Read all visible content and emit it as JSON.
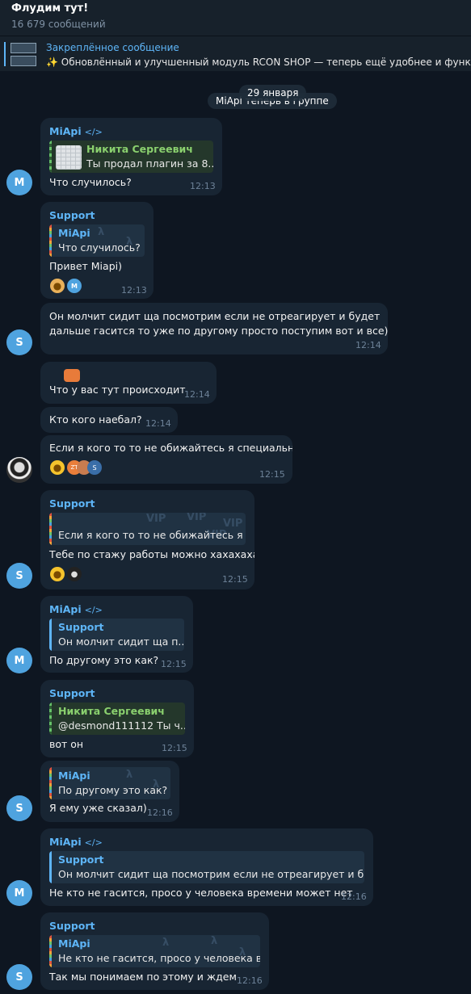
{
  "header": {
    "title": "Флудим тут!",
    "subtitle": "16 679 сообщений"
  },
  "pinned": {
    "label": "Закреплённое сообщение",
    "text": "✨ Обновлённый и улучшенный модуль RCON SHOP — теперь ещё удобнее и функ"
  },
  "date_pill": "29 января",
  "service_message": "MiApi теперь в группе",
  "code_icon": "</>",
  "messages": [
    {
      "sender": "MiApi",
      "reply_name": "Никита Сергеевич",
      "reply_text": "Ты продал плагин за 8...",
      "text": "Что случилось?",
      "time": "12:13",
      "avatar": "M"
    },
    {
      "sender": "Support",
      "reply_name": "MiApi",
      "reply_text": "Что случилось?",
      "text": "Привет Miapi)",
      "time": "12:13",
      "reaction_avatar": "M"
    },
    {
      "text_line1": "Он молчит сидит ща посмотрим если не отреагирует и будет",
      "text_line2": "дальше гасится то уже по другому просто поступим вот и все)",
      "time": "12:14",
      "avatar": "S"
    },
    {
      "text": "Что у вас тут происходит",
      "time": "12:14"
    },
    {
      "text": "Кто кого наебал?",
      "time": "12:14"
    },
    {
      "text": "Если я кого то то не обижайтесь я специально",
      "time": "12:15",
      "reaction_labels": [
        "ZT",
        "S"
      ]
    },
    {
      "sender": "Support",
      "reply_text": "Если я кого то то не обижайтесь я ...",
      "text": "Тебе по стажу работы можно хахахаха",
      "time": "12:15",
      "avatar": "S"
    },
    {
      "sender": "MiApi",
      "reply_name": "Support",
      "reply_text": "Он молчит сидит ща п...",
      "text": "По другому это как?",
      "time": "12:15",
      "avatar": "M"
    },
    {
      "sender": "Support",
      "reply_name": "Никита Сергеевич",
      "reply_text": "@desmond111112 Ты ч...",
      "text": "вот он",
      "time": "12:15"
    },
    {
      "reply_name": "MiApi",
      "reply_text": "По другому это как?",
      "text": "Я ему уже сказал)",
      "time": "12:16",
      "avatar": "S"
    },
    {
      "sender": "MiApi",
      "reply_name": "Support",
      "reply_text": "Он молчит сидит ща посмотрим если не отреагирует и б...",
      "text": "Не кто не гасится, просо у человека времени может нет",
      "time": "12:16",
      "avatar": "M"
    },
    {
      "sender": "Support",
      "reply_name": "MiApi",
      "reply_text": "Не кто не гасится, просо у человека в...",
      "text": "Так мы понимаем по этому и ждем",
      "time": "12:16",
      "avatar": "S"
    }
  ],
  "pattern_glyph": "λ",
  "vip_glyph": "VIP",
  "colors": {
    "background": "#0e1621",
    "bubble": "#182533",
    "accent": "#5eb5f7",
    "green_name": "#8ad06e"
  }
}
